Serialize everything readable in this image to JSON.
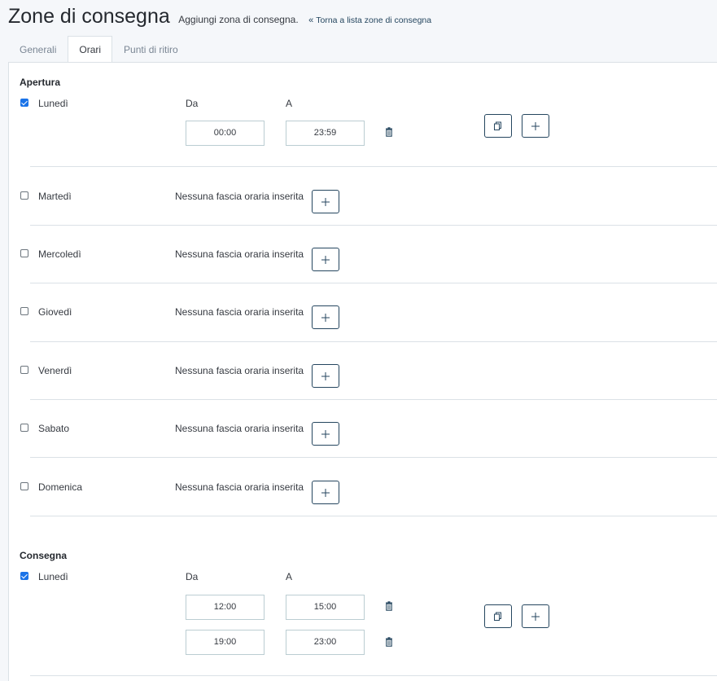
{
  "header": {
    "title": "Zone di consegna",
    "subtitle": "Aggiungi zona di consegna.",
    "back_link": "Torna a lista zone di consegna"
  },
  "tabs": [
    {
      "label": "Generali",
      "active": false
    },
    {
      "label": "Orari",
      "active": true
    },
    {
      "label": "Punti di ritiro",
      "active": false
    }
  ],
  "columns": {
    "from": "Da",
    "to": "A"
  },
  "no_slot_text": "Nessuna fascia oraria inserita",
  "opening": {
    "title": "Apertura",
    "days": [
      {
        "name": "Lunedì",
        "checked": true,
        "slots": [
          {
            "from": "00:00",
            "to": "23:59"
          }
        ]
      },
      {
        "name": "Martedì",
        "checked": false
      },
      {
        "name": "Mercoledì",
        "checked": false
      },
      {
        "name": "Giovedì",
        "checked": false
      },
      {
        "name": "Venerdì",
        "checked": false
      },
      {
        "name": "Sabato",
        "checked": false
      },
      {
        "name": "Domenica",
        "checked": false
      }
    ]
  },
  "delivery": {
    "title": "Consegna",
    "days": [
      {
        "name": "Lunedì",
        "checked": true,
        "slots": [
          {
            "from": "12:00",
            "to": "15:00"
          },
          {
            "from": "19:00",
            "to": "23:00"
          }
        ]
      }
    ]
  },
  "icons": {
    "copy": "copy-icon",
    "add": "plus-icon",
    "delete": "trash-icon",
    "back": "double-chevron-left-icon"
  },
  "colors": {
    "accent": "#25465f",
    "checkbox": "#1a73e8",
    "border": "#bbcdd2",
    "background": "#f5f7fa"
  }
}
